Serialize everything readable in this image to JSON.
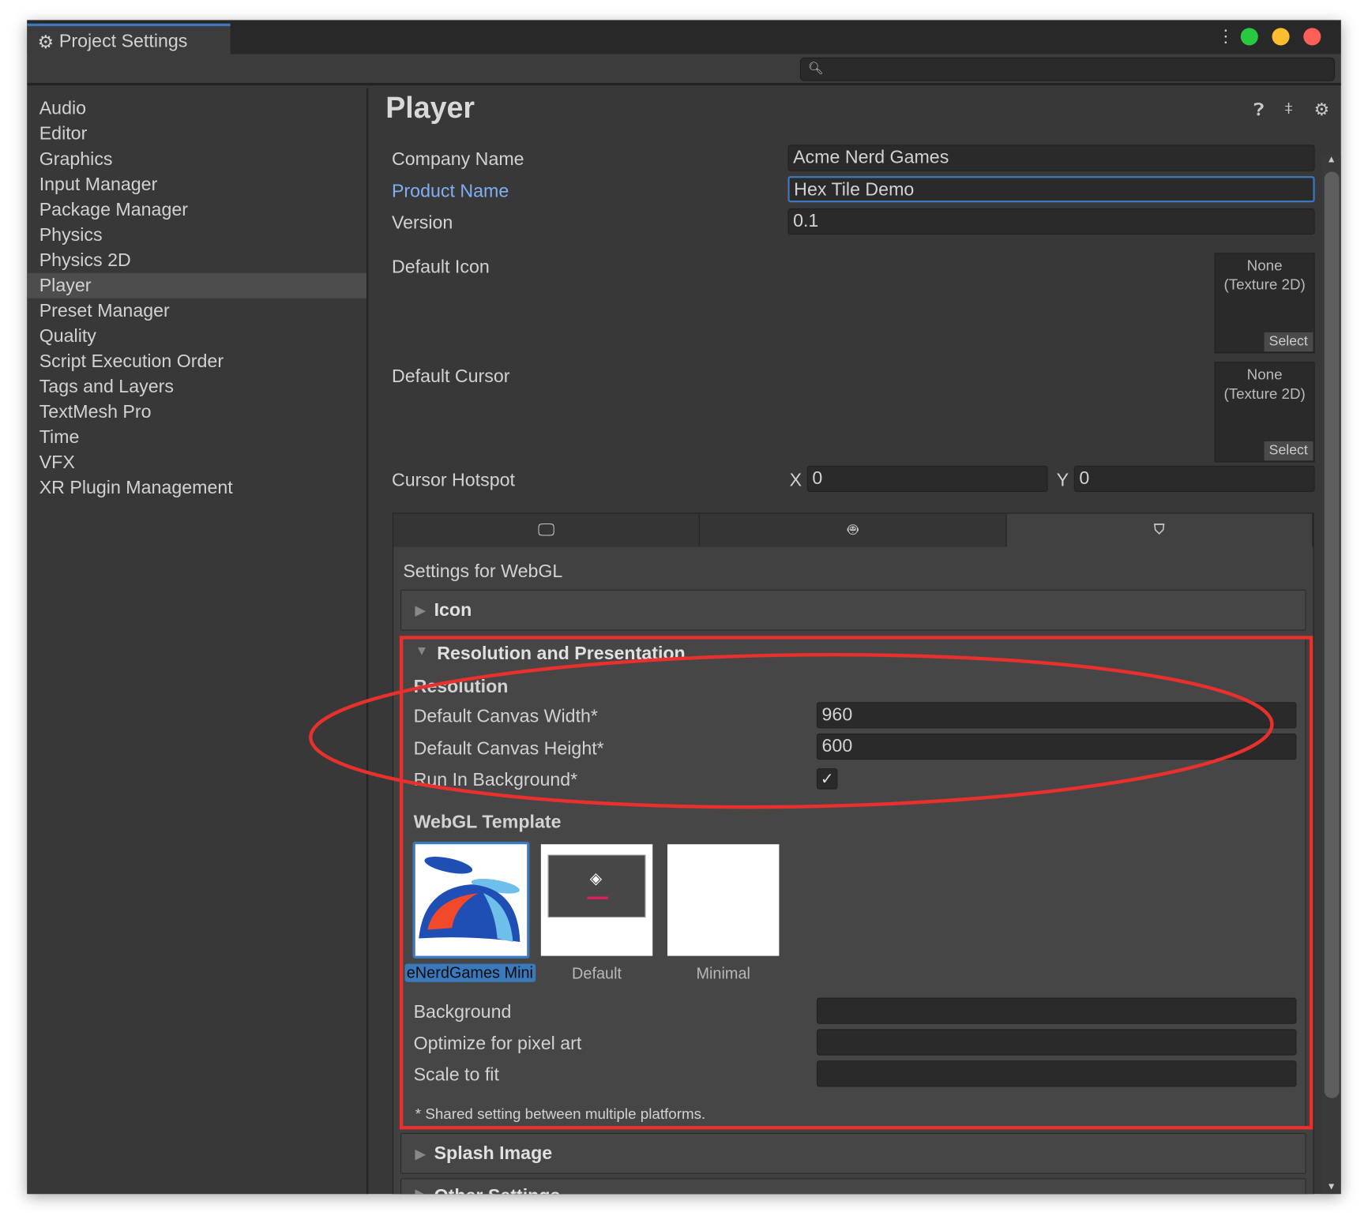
{
  "window": {
    "tab_title": "Project Settings",
    "search_placeholder": "",
    "traffic_colors": [
      "#28c840",
      "#febc2e",
      "#ff5f57"
    ]
  },
  "sidebar": {
    "items": [
      {
        "label": "Audio"
      },
      {
        "label": "Editor"
      },
      {
        "label": "Graphics"
      },
      {
        "label": "Input Manager"
      },
      {
        "label": "Package Manager"
      },
      {
        "label": "Physics"
      },
      {
        "label": "Physics 2D"
      },
      {
        "label": "Player",
        "selected": true
      },
      {
        "label": "Preset Manager"
      },
      {
        "label": "Quality"
      },
      {
        "label": "Script Execution Order"
      },
      {
        "label": "Tags and Layers"
      },
      {
        "label": "TextMesh Pro"
      },
      {
        "label": "Time"
      },
      {
        "label": "VFX"
      },
      {
        "label": "XR Plugin Management"
      }
    ]
  },
  "player": {
    "title": "Player",
    "company_label": "Company Name",
    "company_value": "Acme Nerd Games",
    "product_label": "Product Name",
    "product_value": "Hex Tile Demo",
    "version_label": "Version",
    "version_value": "0.1",
    "icon_label": "Default Icon",
    "icon_value": "None\n(Texture 2D)",
    "select_label": "Select",
    "cursor_label": "Default Cursor",
    "cursor_value": "None\n(Texture 2D)",
    "hotspot_label": "Cursor Hotspot",
    "hotspot_x_label": "X",
    "hotspot_x": "0",
    "hotspot_y_label": "Y",
    "hotspot_y": "0",
    "platform_tabs": [
      {
        "icon": "desktop-icon"
      },
      {
        "icon": "android-icon"
      },
      {
        "icon": "html5-icon",
        "active": true
      }
    ],
    "settings_for": "Settings for WebGL",
    "icon_section": "Icon",
    "res_section": "Resolution and Presentation",
    "resolution_header": "Resolution",
    "canvas_width_label": "Default Canvas Width*",
    "canvas_width": "960",
    "canvas_height_label": "Default Canvas Height*",
    "canvas_height": "600",
    "run_bg_label": "Run In Background*",
    "run_bg_checked": true,
    "template_header": "WebGL Template",
    "templates": [
      {
        "label": "eNerdGames Mini",
        "selected": true
      },
      {
        "label": "Default"
      },
      {
        "label": "Minimal"
      }
    ],
    "background_label": "Background",
    "pixel_art_label": "Optimize for pixel art",
    "scale_fit_label": "Scale to fit",
    "shared_note": "* Shared setting between multiple platforms.",
    "splash_section": "Splash Image",
    "other_section": "Other Settings"
  },
  "annotation_color": "#e8302c"
}
